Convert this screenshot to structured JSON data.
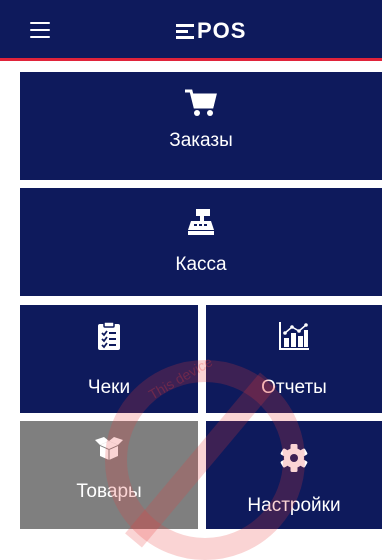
{
  "header": {
    "logo_text": "POS",
    "menu_icon": "hamburger-icon"
  },
  "tiles": [
    {
      "label": "Заказы",
      "icon": "cart-icon"
    },
    {
      "label": "Касса",
      "icon": "cash-register-icon"
    },
    {
      "label": "Чеки",
      "icon": "clipboard-checklist-icon"
    },
    {
      "label": "Отчеты",
      "icon": "bar-chart-icon"
    },
    {
      "label": "Товары",
      "icon": "box-open-icon"
    },
    {
      "label": "Настройки",
      "icon": "gear-icon"
    }
  ],
  "watermark": {
    "text": "This device"
  },
  "colors": {
    "primary": "#0e1a5c",
    "accent": "#e0233a",
    "disabled": "#7f7f7f"
  }
}
